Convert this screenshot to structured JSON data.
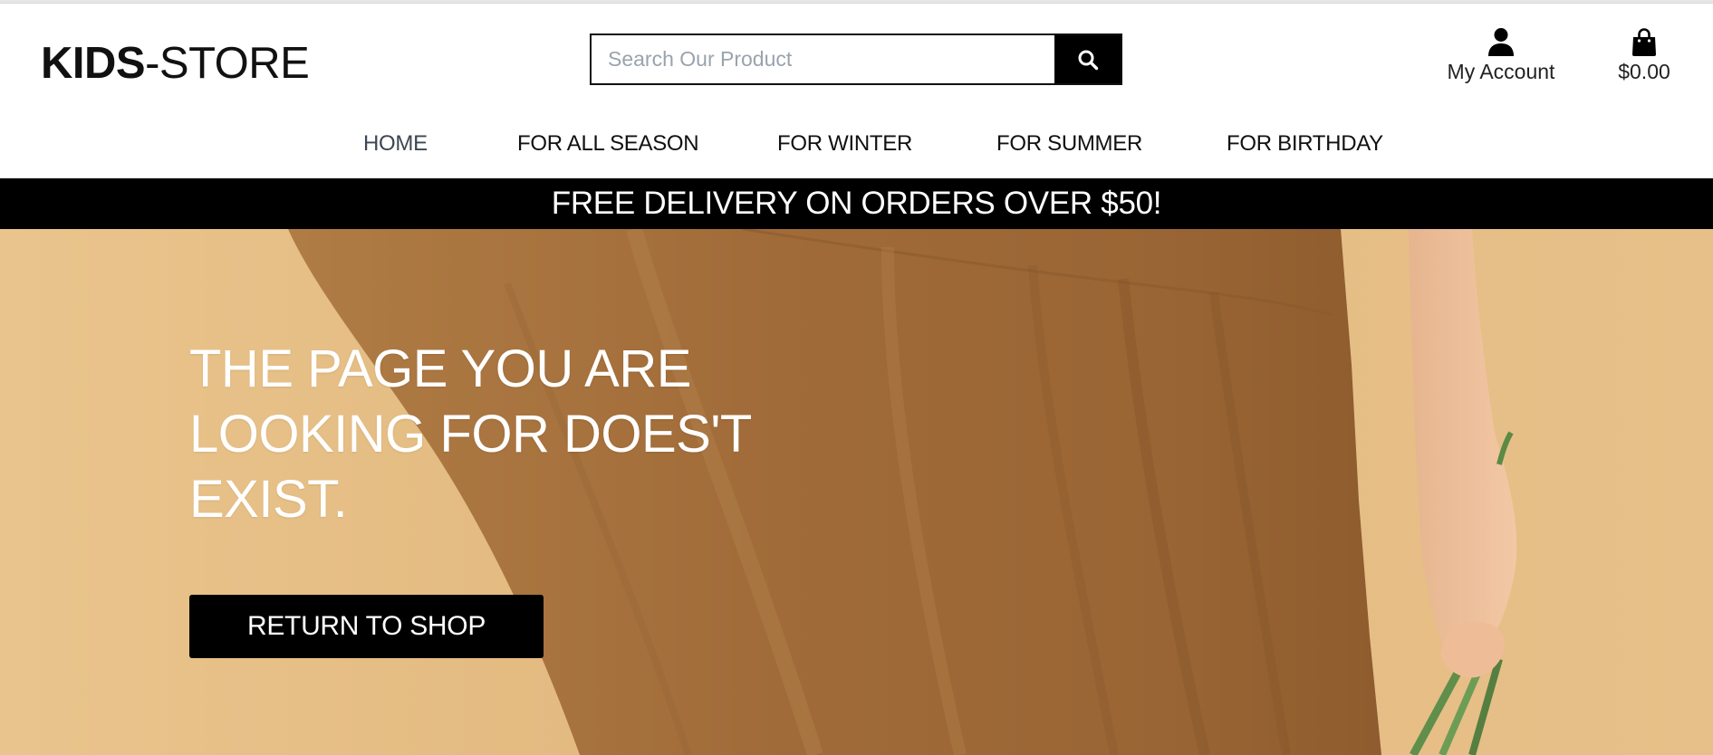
{
  "header": {
    "logo": {
      "bold": "KIDS",
      "light": "-STORE"
    },
    "search": {
      "placeholder": "Search Our Product",
      "value": "",
      "button_icon": "search-icon"
    },
    "account": {
      "icon": "user-icon",
      "label": "My Account"
    },
    "cart": {
      "icon": "shopping-bag-icon",
      "total": "$0.00"
    }
  },
  "nav": {
    "items": [
      {
        "label": "HOME",
        "active": true
      },
      {
        "label": "FOR ALL SEASON",
        "active": false
      },
      {
        "label": "FOR WINTER",
        "active": false
      },
      {
        "label": "FOR SUMMER",
        "active": false
      },
      {
        "label": "FOR BIRTHDAY",
        "active": false
      }
    ]
  },
  "promo": {
    "text": "FREE DELIVERY ON ORDERS OVER $50!"
  },
  "hero": {
    "heading_lines": [
      "THE PAGE YOU ARE",
      "LOOKING FOR DOES'T",
      "EXIST."
    ],
    "button_label": "RETURN TO SHOP"
  },
  "colors": {
    "accent": "#000000",
    "hero_background": "#e6bf88",
    "dress": "#a87540",
    "text_on_dark": "#ffffff"
  }
}
